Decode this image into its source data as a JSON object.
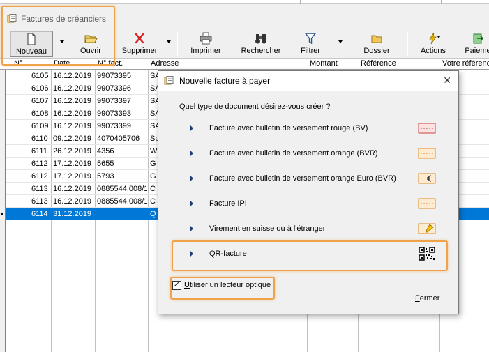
{
  "window": {
    "title": "Factures de créanciers"
  },
  "toolbar": {
    "new_label": "Nouveau",
    "open_label": "Ouvrir",
    "delete_label": "Supprimer",
    "print_label": "Imprimer",
    "search_label": "Rechercher",
    "filter_label": "Filtrer",
    "folder_label": "Dossier",
    "actions_label": "Actions",
    "payments_label": "Paieme"
  },
  "table": {
    "headers": {
      "num": "N° ...",
      "date": "Date",
      "fact": "N° fact.",
      "address": "Adresse",
      "amount": "Montant",
      "reference": "Référence",
      "your_ref": "Votre référence"
    },
    "rows": [
      {
        "num": "6105",
        "date": "16.12.2019",
        "fact": "99073395",
        "addr": "SA"
      },
      {
        "num": "6106",
        "date": "16.12.2019",
        "fact": "99073396",
        "addr": "SA"
      },
      {
        "num": "6107",
        "date": "16.12.2019",
        "fact": "99073397",
        "addr": "SA"
      },
      {
        "num": "6108",
        "date": "16.12.2019",
        "fact": "99073393",
        "addr": "SA"
      },
      {
        "num": "6109",
        "date": "16.12.2019",
        "fact": "99073399",
        "addr": "SA"
      },
      {
        "num": "6110",
        "date": "09.12.2019",
        "fact": "4070405706",
        "addr": "Sp"
      },
      {
        "num": "6111",
        "date": "26.12.2019",
        "fact": "4356",
        "addr": "W"
      },
      {
        "num": "6112",
        "date": "17.12.2019",
        "fact": "5655",
        "addr": "G"
      },
      {
        "num": "6112",
        "date": "17.12.2019",
        "fact": "5793",
        "addr": "G"
      },
      {
        "num": "6113",
        "date": "16.12.2019",
        "fact": "0885544.008/1",
        "addr": "C"
      },
      {
        "num": "6113",
        "date": "16.12.2019",
        "fact": "0885544.008/1",
        "addr": "C"
      },
      {
        "num": "6114",
        "date": "31.12.2019",
        "fact": "",
        "addr": "Q"
      }
    ]
  },
  "dialog": {
    "title": "Nouvelle facture à payer",
    "close_glyph": "✕",
    "question": "Quel type de document désirez-vous créer ?",
    "options": [
      {
        "label": "Facture avec bulletin de versement rouge (BV)"
      },
      {
        "label": "Facture avec bulletin de versement orange (BVR)"
      },
      {
        "label": "Facture avec bulletin de versement orange Euro (BVR)"
      },
      {
        "label": "Facture IPI"
      },
      {
        "label": "Virement en suisse ou à l'étranger"
      },
      {
        "label": "QR-facture"
      }
    ],
    "optical_reader": {
      "label_u": "U",
      "label_rest": "tiliser un lecteur optique",
      "checked_glyph": "✓"
    },
    "close_u": "F",
    "close_rest": "ermer"
  },
  "colors": {
    "highlight": "#f0a24a",
    "selection": "#0078d7",
    "bv_red": "#e05050",
    "bvr_orange": "#f0a040"
  }
}
